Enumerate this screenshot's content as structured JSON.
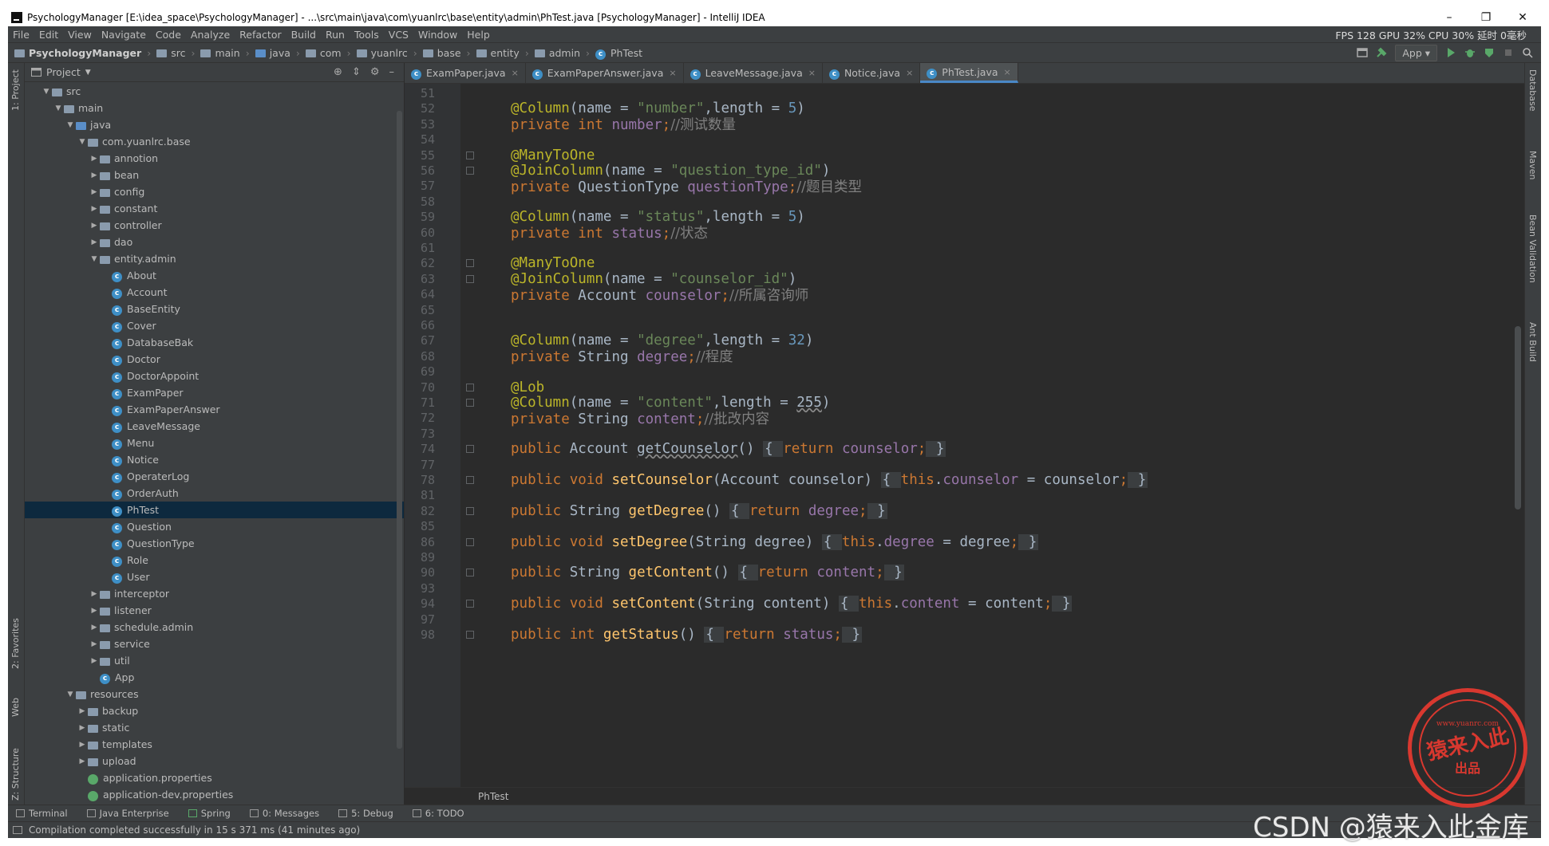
{
  "window": {
    "title": "PsychologyManager [E:\\idea_space\\PsychologyManager] - ...\\src\\main\\java\\com\\yuanlrc\\base\\entity\\admin\\PhTest.java [PsychologyManager] - IntelliJ IDEA",
    "minimize": "–",
    "maximize": "❐",
    "close": "✕"
  },
  "menu": {
    "items": [
      "File",
      "Edit",
      "View",
      "Navigate",
      "Code",
      "Analyze",
      "Refactor",
      "Build",
      "Run",
      "Tools",
      "VCS",
      "Window",
      "Help"
    ],
    "perf": "FPS 128 GPU 32% CPU 30% 延时 0毫秒"
  },
  "navbar": {
    "crumbs": [
      "PsychologyManager",
      "src",
      "main",
      "java",
      "com",
      "yuanlrc",
      "base",
      "entity",
      "admin",
      "PhTest"
    ],
    "run_config": "App"
  },
  "left_strip": {
    "project": "1: Project",
    "favorites": "2: Favorites",
    "web": "Web",
    "structure": "Z: Structure"
  },
  "right_strip": {
    "database": "Database",
    "maven": "Maven",
    "bean_validation": "Bean Validation",
    "ant_build": "Ant Build"
  },
  "project_panel": {
    "title": "Project",
    "tree": [
      {
        "label": "src",
        "depth": 0,
        "kind": "folder",
        "arrow": "down"
      },
      {
        "label": "main",
        "depth": 1,
        "kind": "folder",
        "arrow": "down"
      },
      {
        "label": "java",
        "depth": 2,
        "kind": "folder-blue",
        "arrow": "down"
      },
      {
        "label": "com.yuanlrc.base",
        "depth": 3,
        "kind": "folder",
        "arrow": "down"
      },
      {
        "label": "annotion",
        "depth": 4,
        "kind": "folder",
        "arrow": "right"
      },
      {
        "label": "bean",
        "depth": 4,
        "kind": "folder",
        "arrow": "right"
      },
      {
        "label": "config",
        "depth": 4,
        "kind": "folder",
        "arrow": "right"
      },
      {
        "label": "constant",
        "depth": 4,
        "kind": "folder",
        "arrow": "right"
      },
      {
        "label": "controller",
        "depth": 4,
        "kind": "folder",
        "arrow": "right"
      },
      {
        "label": "dao",
        "depth": 4,
        "kind": "folder",
        "arrow": "right"
      },
      {
        "label": "entity.admin",
        "depth": 4,
        "kind": "folder",
        "arrow": "down"
      },
      {
        "label": "About",
        "depth": 5,
        "kind": "class",
        "arrow": ""
      },
      {
        "label": "Account",
        "depth": 5,
        "kind": "class",
        "arrow": ""
      },
      {
        "label": "BaseEntity",
        "depth": 5,
        "kind": "class",
        "arrow": ""
      },
      {
        "label": "Cover",
        "depth": 5,
        "kind": "class",
        "arrow": ""
      },
      {
        "label": "DatabaseBak",
        "depth": 5,
        "kind": "class",
        "arrow": ""
      },
      {
        "label": "Doctor",
        "depth": 5,
        "kind": "class",
        "arrow": ""
      },
      {
        "label": "DoctorAppoint",
        "depth": 5,
        "kind": "class",
        "arrow": ""
      },
      {
        "label": "ExamPaper",
        "depth": 5,
        "kind": "class",
        "arrow": ""
      },
      {
        "label": "ExamPaperAnswer",
        "depth": 5,
        "kind": "class",
        "arrow": ""
      },
      {
        "label": "LeaveMessage",
        "depth": 5,
        "kind": "class",
        "arrow": ""
      },
      {
        "label": "Menu",
        "depth": 5,
        "kind": "class",
        "arrow": ""
      },
      {
        "label": "Notice",
        "depth": 5,
        "kind": "class",
        "arrow": ""
      },
      {
        "label": "OperaterLog",
        "depth": 5,
        "kind": "class",
        "arrow": ""
      },
      {
        "label": "OrderAuth",
        "depth": 5,
        "kind": "class",
        "arrow": ""
      },
      {
        "label": "PhTest",
        "depth": 5,
        "kind": "class",
        "arrow": "",
        "selected": true
      },
      {
        "label": "Question",
        "depth": 5,
        "kind": "class",
        "arrow": ""
      },
      {
        "label": "QuestionType",
        "depth": 5,
        "kind": "class",
        "arrow": ""
      },
      {
        "label": "Role",
        "depth": 5,
        "kind": "class",
        "arrow": ""
      },
      {
        "label": "User",
        "depth": 5,
        "kind": "class",
        "arrow": ""
      },
      {
        "label": "interceptor",
        "depth": 4,
        "kind": "folder",
        "arrow": "right"
      },
      {
        "label": "listener",
        "depth": 4,
        "kind": "folder",
        "arrow": "right"
      },
      {
        "label": "schedule.admin",
        "depth": 4,
        "kind": "folder",
        "arrow": "right"
      },
      {
        "label": "service",
        "depth": 4,
        "kind": "folder",
        "arrow": "right"
      },
      {
        "label": "util",
        "depth": 4,
        "kind": "folder",
        "arrow": "right"
      },
      {
        "label": "App",
        "depth": 4,
        "kind": "class",
        "arrow": ""
      },
      {
        "label": "resources",
        "depth": 2,
        "kind": "folder",
        "arrow": "down"
      },
      {
        "label": "backup",
        "depth": 3,
        "kind": "folder",
        "arrow": "right"
      },
      {
        "label": "static",
        "depth": 3,
        "kind": "folder",
        "arrow": "right"
      },
      {
        "label": "templates",
        "depth": 3,
        "kind": "folder",
        "arrow": "right"
      },
      {
        "label": "upload",
        "depth": 3,
        "kind": "folder",
        "arrow": "right"
      },
      {
        "label": "application.properties",
        "depth": 3,
        "kind": "file",
        "arrow": ""
      },
      {
        "label": "application-dev.properties",
        "depth": 3,
        "kind": "file",
        "arrow": ""
      }
    ]
  },
  "editor": {
    "tabs": [
      {
        "label": "ExamPaper.java",
        "active": false
      },
      {
        "label": "ExamPaperAnswer.java",
        "active": false
      },
      {
        "label": "LeaveMessage.java",
        "active": false
      },
      {
        "label": "Notice.java",
        "active": false
      },
      {
        "label": "PhTest.java",
        "active": true
      }
    ],
    "tab_close": "×",
    "breadcrumb": "PhTest",
    "lines": [
      {
        "num": "51",
        "fold": "",
        "tokens": []
      },
      {
        "num": "52",
        "fold": "",
        "tokens": [
          [
            "an",
            "@Column"
          ],
          [
            "pl",
            "(name = "
          ],
          [
            "st",
            "\"number\""
          ],
          [
            "pl",
            ","
          ],
          [
            "pl",
            "length = "
          ],
          [
            "nm",
            "5"
          ],
          [
            "pl",
            ")"
          ]
        ]
      },
      {
        "num": "53",
        "fold": "",
        "tokens": [
          [
            "kw",
            "private int "
          ],
          [
            "fd",
            "number"
          ],
          [
            "kw",
            ";"
          ],
          [
            "cm",
            "//测试数量"
          ]
        ]
      },
      {
        "num": "54",
        "fold": "",
        "tokens": []
      },
      {
        "num": "55",
        "fold": "open",
        "tokens": [
          [
            "an",
            "@ManyToOne"
          ]
        ]
      },
      {
        "num": "56",
        "fold": "close",
        "tokens": [
          [
            "an",
            "@JoinColumn"
          ],
          [
            "pl",
            "(name = "
          ],
          [
            "st",
            "\"question_type_id\""
          ],
          [
            "pl",
            ")"
          ]
        ]
      },
      {
        "num": "57",
        "fold": "",
        "tokens": [
          [
            "kw",
            "private "
          ],
          [
            "pl",
            "QuestionType "
          ],
          [
            "fd",
            "questionType"
          ],
          [
            "kw",
            ";"
          ],
          [
            "cm",
            "//题目类型"
          ]
        ]
      },
      {
        "num": "58",
        "fold": "",
        "tokens": []
      },
      {
        "num": "59",
        "fold": "",
        "tokens": [
          [
            "an",
            "@Column"
          ],
          [
            "pl",
            "(name = "
          ],
          [
            "st",
            "\"status\""
          ],
          [
            "pl",
            ","
          ],
          [
            "pl",
            "length = "
          ],
          [
            "nm",
            "5"
          ],
          [
            "pl",
            ")"
          ]
        ]
      },
      {
        "num": "60",
        "fold": "",
        "tokens": [
          [
            "kw",
            "private int "
          ],
          [
            "fd",
            "status"
          ],
          [
            "kw",
            ";"
          ],
          [
            "cm",
            "//状态"
          ]
        ]
      },
      {
        "num": "61",
        "fold": "",
        "tokens": []
      },
      {
        "num": "62",
        "fold": "open",
        "tokens": [
          [
            "an",
            "@ManyToOne"
          ]
        ]
      },
      {
        "num": "63",
        "fold": "close",
        "tokens": [
          [
            "an",
            "@JoinColumn"
          ],
          [
            "pl",
            "(name = "
          ],
          [
            "st",
            "\"counselor_id\""
          ],
          [
            "pl",
            ")"
          ]
        ]
      },
      {
        "num": "64",
        "fold": "",
        "tokens": [
          [
            "kw",
            "private "
          ],
          [
            "pl",
            "Account "
          ],
          [
            "fd",
            "counselor"
          ],
          [
            "kw",
            ";"
          ],
          [
            "cm",
            "//所属咨询师"
          ]
        ]
      },
      {
        "num": "65",
        "fold": "",
        "tokens": []
      },
      {
        "num": "66",
        "fold": "",
        "tokens": []
      },
      {
        "num": "67",
        "fold": "",
        "tokens": [
          [
            "an",
            "@Column"
          ],
          [
            "pl",
            "(name = "
          ],
          [
            "st",
            "\"degree\""
          ],
          [
            "pl",
            ","
          ],
          [
            "pl",
            "length = "
          ],
          [
            "nm",
            "32"
          ],
          [
            "pl",
            ")"
          ]
        ]
      },
      {
        "num": "68",
        "fold": "",
        "tokens": [
          [
            "kw",
            "private "
          ],
          [
            "pl",
            "String "
          ],
          [
            "fd",
            "degree"
          ],
          [
            "kw",
            ";"
          ],
          [
            "cm",
            "//程度"
          ]
        ]
      },
      {
        "num": "69",
        "fold": "",
        "tokens": []
      },
      {
        "num": "70",
        "fold": "open",
        "tokens": [
          [
            "an",
            "@Lob"
          ]
        ]
      },
      {
        "num": "71",
        "fold": "close",
        "tokens": [
          [
            "an",
            "@Column"
          ],
          [
            "pl",
            "(name = "
          ],
          [
            "st",
            "\"content\""
          ],
          [
            "pl",
            ","
          ],
          [
            "pl",
            "length = "
          ],
          [
            "wv",
            "255"
          ],
          [
            "pl",
            ")"
          ]
        ]
      },
      {
        "num": "72",
        "fold": "",
        "tokens": [
          [
            "kw",
            "private "
          ],
          [
            "pl",
            "String "
          ],
          [
            "fd",
            "content"
          ],
          [
            "kw",
            ";"
          ],
          [
            "cm",
            "//批改内容"
          ]
        ]
      },
      {
        "num": "73",
        "fold": "",
        "tokens": []
      },
      {
        "num": "74",
        "fold": "plus",
        "tokens": [
          [
            "kw",
            "public "
          ],
          [
            "pl",
            "Account "
          ],
          [
            "wv",
            "getCounselor"
          ],
          [
            "pl",
            "() "
          ],
          [
            "fb",
            "{ "
          ],
          [
            "kw",
            "return "
          ],
          [
            "fd",
            "counselor"
          ],
          [
            "kw",
            ";"
          ],
          [
            "fb",
            " }"
          ]
        ]
      },
      {
        "num": "77",
        "fold": "",
        "tokens": []
      },
      {
        "num": "78",
        "fold": "plus",
        "tokens": [
          [
            "kw",
            "public void "
          ],
          [
            "fn",
            "setCounselor"
          ],
          [
            "pl",
            "(Account counselor) "
          ],
          [
            "fb",
            "{ "
          ],
          [
            "kw",
            "this"
          ],
          [
            "pl",
            "."
          ],
          [
            "fd",
            "counselor"
          ],
          [
            "pl",
            " = counselor"
          ],
          [
            "kw",
            ";"
          ],
          [
            "fb",
            " }"
          ]
        ]
      },
      {
        "num": "81",
        "fold": "",
        "tokens": []
      },
      {
        "num": "82",
        "fold": "plus",
        "tokens": [
          [
            "kw",
            "public "
          ],
          [
            "pl",
            "String "
          ],
          [
            "fn",
            "getDegree"
          ],
          [
            "pl",
            "() "
          ],
          [
            "fb",
            "{ "
          ],
          [
            "kw",
            "return "
          ],
          [
            "fd",
            "degree"
          ],
          [
            "kw",
            ";"
          ],
          [
            "fb",
            " }"
          ]
        ]
      },
      {
        "num": "85",
        "fold": "",
        "tokens": []
      },
      {
        "num": "86",
        "fold": "plus",
        "tokens": [
          [
            "kw",
            "public void "
          ],
          [
            "fn",
            "setDegree"
          ],
          [
            "pl",
            "(String degree) "
          ],
          [
            "fb",
            "{ "
          ],
          [
            "kw",
            "this"
          ],
          [
            "pl",
            "."
          ],
          [
            "fd",
            "degree"
          ],
          [
            "pl",
            " = degree"
          ],
          [
            "kw",
            ";"
          ],
          [
            "fb",
            " }"
          ]
        ]
      },
      {
        "num": "89",
        "fold": "",
        "tokens": []
      },
      {
        "num": "90",
        "fold": "plus",
        "tokens": [
          [
            "kw",
            "public "
          ],
          [
            "pl",
            "String "
          ],
          [
            "fn",
            "getContent"
          ],
          [
            "pl",
            "() "
          ],
          [
            "fb",
            "{ "
          ],
          [
            "kw",
            "return "
          ],
          [
            "fd",
            "content"
          ],
          [
            "kw",
            ";"
          ],
          [
            "fb",
            " }"
          ]
        ]
      },
      {
        "num": "93",
        "fold": "",
        "tokens": []
      },
      {
        "num": "94",
        "fold": "plus",
        "tokens": [
          [
            "kw",
            "public void "
          ],
          [
            "fn",
            "setContent"
          ],
          [
            "pl",
            "(String content) "
          ],
          [
            "fb",
            "{ "
          ],
          [
            "kw",
            "this"
          ],
          [
            "pl",
            "."
          ],
          [
            "fd",
            "content"
          ],
          [
            "pl",
            " = content"
          ],
          [
            "kw",
            ";"
          ],
          [
            "fb",
            " }"
          ]
        ]
      },
      {
        "num": "97",
        "fold": "",
        "tokens": []
      },
      {
        "num": "98",
        "fold": "plus",
        "tokens": [
          [
            "kw",
            "public int "
          ],
          [
            "fn",
            "getStatus"
          ],
          [
            "pl",
            "() "
          ],
          [
            "fb",
            "{ "
          ],
          [
            "kw",
            "return "
          ],
          [
            "fd",
            "status"
          ],
          [
            "kw",
            ";"
          ],
          [
            "fb",
            " }"
          ]
        ]
      }
    ]
  },
  "bottom_tools": [
    "Terminal",
    "Java Enterprise",
    "Spring",
    "0: Messages",
    "5: Debug",
    "6: TODO"
  ],
  "status": "Compilation completed successfully in 15 s 371 ms (41 minutes ago)",
  "watermark": {
    "csdn": "CSDN @猿来入此金库",
    "stamp_url": "www.yuanrc.com",
    "stamp_main": "猿来入此",
    "stamp_sub": "出品"
  },
  "colors": {
    "keyword": "#cc7832",
    "annotation": "#bbb529",
    "string": "#6a8759",
    "number": "#6897bb",
    "field": "#9876aa",
    "comment": "#808080",
    "method": "#ffc66d",
    "selection": "#0d293e",
    "tab_underline": "#4a88c7"
  }
}
